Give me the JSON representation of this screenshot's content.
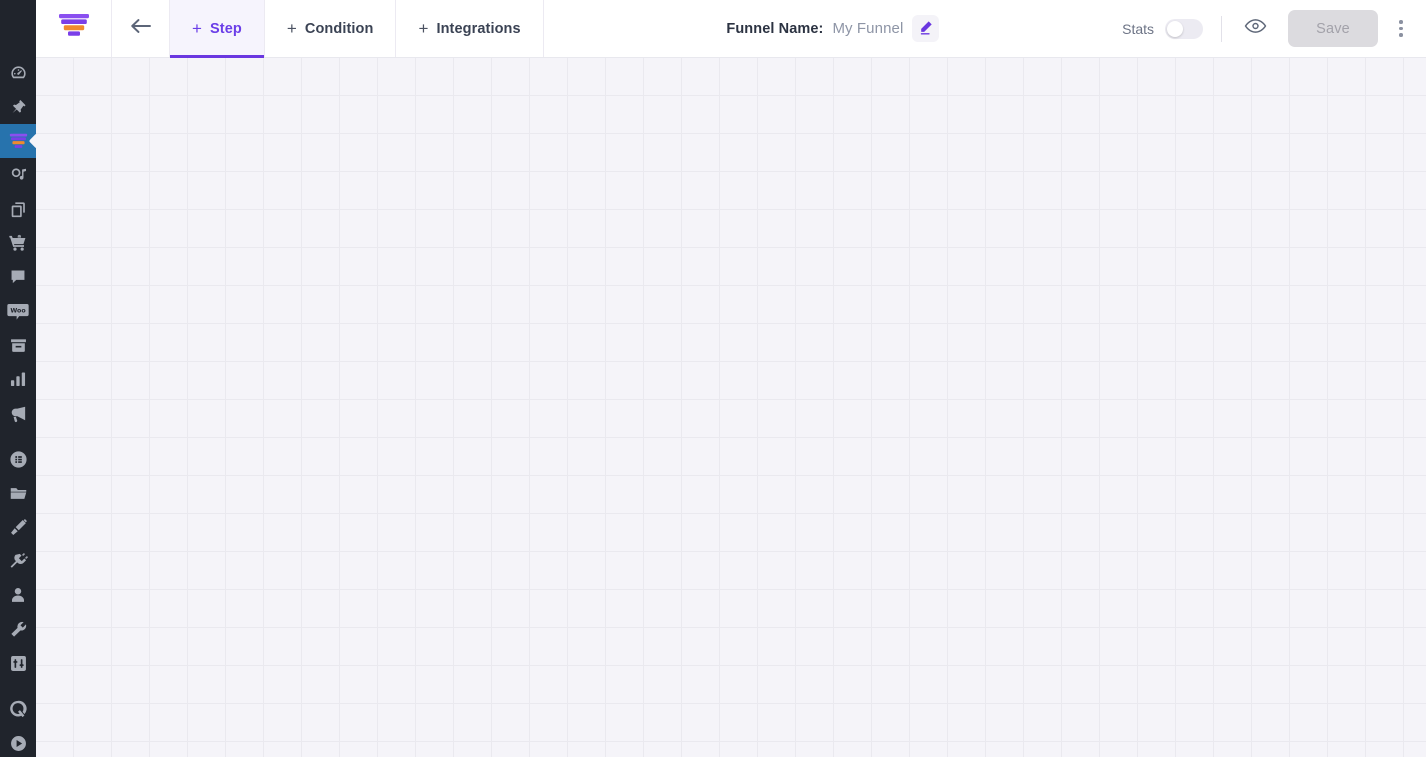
{
  "app": {
    "logo_icon": "funnel-logo-icon",
    "brand_purple": "#6a37e0",
    "brand_orange": "#f08a2e",
    "sidebar_bg": "#20242c",
    "sidebar_active_bg": "#2773ad",
    "canvas_bg": "#f5f4f9",
    "canvas_grid_color": "#eae9ef"
  },
  "sidebar": {
    "items": [
      {
        "name": "sidebar-item-dashboard",
        "icon": "gauge-icon",
        "active": false
      },
      {
        "name": "sidebar-item-pinned",
        "icon": "pin-icon",
        "active": false
      },
      {
        "name": "sidebar-item-funnels",
        "icon": "funnel-icon",
        "active": true
      },
      {
        "name": "sidebar-item-automation",
        "icon": "automation-icon",
        "active": false
      },
      {
        "name": "sidebar-item-pages",
        "icon": "copy-pages-icon",
        "active": false
      },
      {
        "name": "sidebar-item-cart",
        "icon": "shopping-cart-icon",
        "active": false
      },
      {
        "name": "sidebar-item-messages",
        "icon": "chat-bubble-icon",
        "active": false
      },
      {
        "name": "sidebar-item-woocommerce",
        "icon": "woo-badge-icon",
        "active": false
      },
      {
        "name": "sidebar-item-archive",
        "icon": "archive-box-icon",
        "active": false
      },
      {
        "name": "sidebar-item-analytics",
        "icon": "bar-chart-icon",
        "active": false
      },
      {
        "name": "sidebar-item-campaigns",
        "icon": "megaphone-icon",
        "active": false
      },
      {
        "name": "sidebar-item-forms",
        "icon": "circled-list-icon",
        "active": false
      },
      {
        "name": "sidebar-item-library",
        "icon": "folder-icon",
        "active": false
      },
      {
        "name": "sidebar-item-templates",
        "icon": "paint-roller-icon",
        "active": false
      },
      {
        "name": "sidebar-item-integrations",
        "icon": "plug-icon",
        "active": false
      },
      {
        "name": "sidebar-item-contacts",
        "icon": "user-icon",
        "active": false
      },
      {
        "name": "sidebar-item-tools",
        "icon": "wrench-icon",
        "active": false
      },
      {
        "name": "sidebar-item-settings",
        "icon": "sliders-icon",
        "active": false
      },
      {
        "name": "sidebar-item-quickstart",
        "icon": "q-logo-icon",
        "active": false
      },
      {
        "name": "sidebar-item-help-video",
        "icon": "play-circle-icon",
        "active": false
      }
    ]
  },
  "header": {
    "back_icon": "back-arrow-icon",
    "tabs": [
      {
        "label": "Step",
        "icon": "plus-icon",
        "active": true
      },
      {
        "label": "Condition",
        "icon": "plus-icon",
        "active": false
      },
      {
        "label": "Integrations",
        "icon": "plus-icon",
        "active": false
      }
    ],
    "funnel_name_label": "Funnel Name:",
    "funnel_name_value": "My Funnel",
    "edit_icon": "pencil-edit-icon",
    "stats_label": "Stats",
    "stats_enabled": false,
    "preview_icon": "eye-icon",
    "save_label": "Save",
    "save_disabled": true,
    "more_icon": "kebab-menu-icon"
  },
  "canvas": {
    "grid_size_px": 38,
    "empty": true
  }
}
